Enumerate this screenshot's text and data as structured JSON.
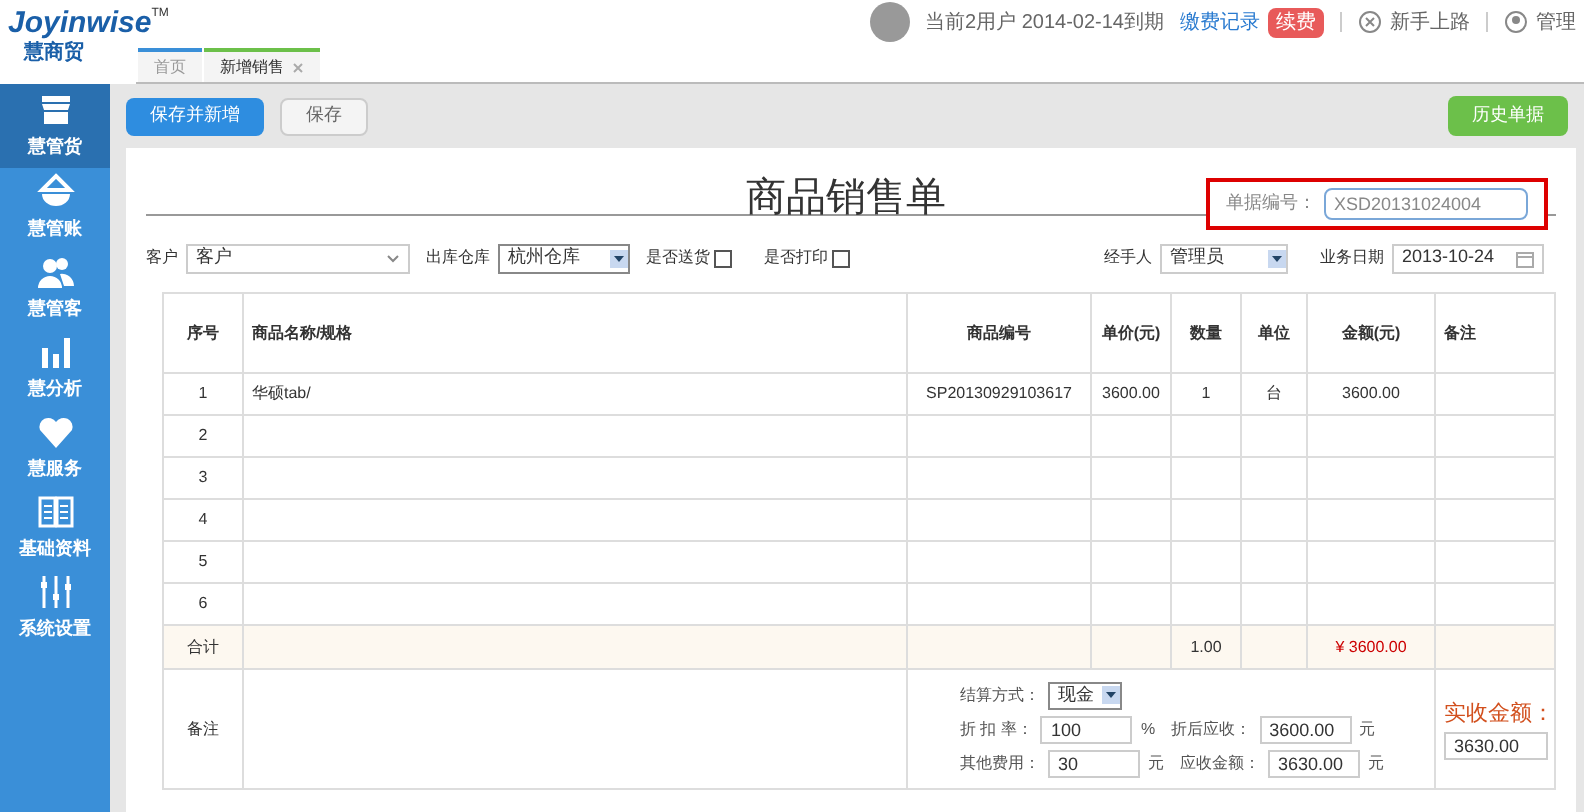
{
  "logo": {
    "brand": "Joyinwise",
    "tm": "TM",
    "subtitle": "慧商贸"
  },
  "header": {
    "account": "当前2用户 2014-02-14到期",
    "payment_link": "缴费记录",
    "renew_badge": "续费",
    "guide": "新手上路",
    "admin": "管理"
  },
  "tabs": [
    {
      "label": "首页",
      "selected": false,
      "closable": false
    },
    {
      "label": "新增销售",
      "selected": true,
      "closable": true
    }
  ],
  "sidebar": {
    "items": [
      {
        "label": "慧管货",
        "selected": true
      },
      {
        "label": "慧管账",
        "selected": false
      },
      {
        "label": "慧管客",
        "selected": false
      },
      {
        "label": "慧分析",
        "selected": false
      },
      {
        "label": "慧服务",
        "selected": false
      },
      {
        "label": "基础资料",
        "selected": false
      },
      {
        "label": "系统设置",
        "selected": false
      }
    ]
  },
  "toolbar": {
    "buttons": [
      {
        "label": "保存并新增",
        "kind": "primary"
      },
      {
        "label": "保存",
        "kind": "default"
      }
    ],
    "history_button": "历史单据"
  },
  "form": {
    "title": "商品销售单",
    "doc_number_label": "单据编号：",
    "doc_number": "XSD20131024004",
    "customer_label": "客户",
    "customer": "客户",
    "warehouse_label": "出库仓库",
    "warehouse": "杭州仓库",
    "checkboxes": [
      {
        "label": "是否送货",
        "checked": false
      },
      {
        "label": "是否打印",
        "checked": false
      }
    ],
    "handler_label": "经手人",
    "handler": "管理员",
    "date_label": "业务日期",
    "date": "2013-10-24"
  },
  "table": {
    "columns": [
      "序号",
      "商品名称/规格",
      "商品编号",
      "单价(元)",
      "数量",
      "单位",
      "金额(元)",
      "备注"
    ],
    "rows": [
      [
        "1",
        "华硕tab/",
        "SP20130929103617",
        "3600.00",
        "1",
        "台",
        "3600.00",
        ""
      ],
      [
        "2",
        "",
        "",
        "",
        "",
        "",
        "",
        ""
      ],
      [
        "3",
        "",
        "",
        "",
        "",
        "",
        "",
        ""
      ],
      [
        "4",
        "",
        "",
        "",
        "",
        "",
        "",
        ""
      ],
      [
        "5",
        "",
        "",
        "",
        "",
        "",
        "",
        ""
      ],
      [
        "6",
        "",
        "",
        "",
        "",
        "",
        "",
        ""
      ]
    ],
    "total": {
      "label": "合计",
      "quantity": "1.00",
      "amount": "¥ 3600.00"
    }
  },
  "footer": {
    "remark_label": "备注",
    "settlement_label": "结算方式：",
    "settlement": "现金",
    "discount_label": "折 扣 率：",
    "discount": "100",
    "percent": "%",
    "after_discount_label": "折后应收：",
    "after_discount": "3600.00",
    "yuan1": "元",
    "other_fee_label": "其他费用：",
    "other_fee": "30",
    "yuan2": "元",
    "receivable_label": "应收金额：",
    "receivable": "3630.00",
    "yuan3": "元",
    "received_label": "实收金额：",
    "received": "3630.00"
  }
}
